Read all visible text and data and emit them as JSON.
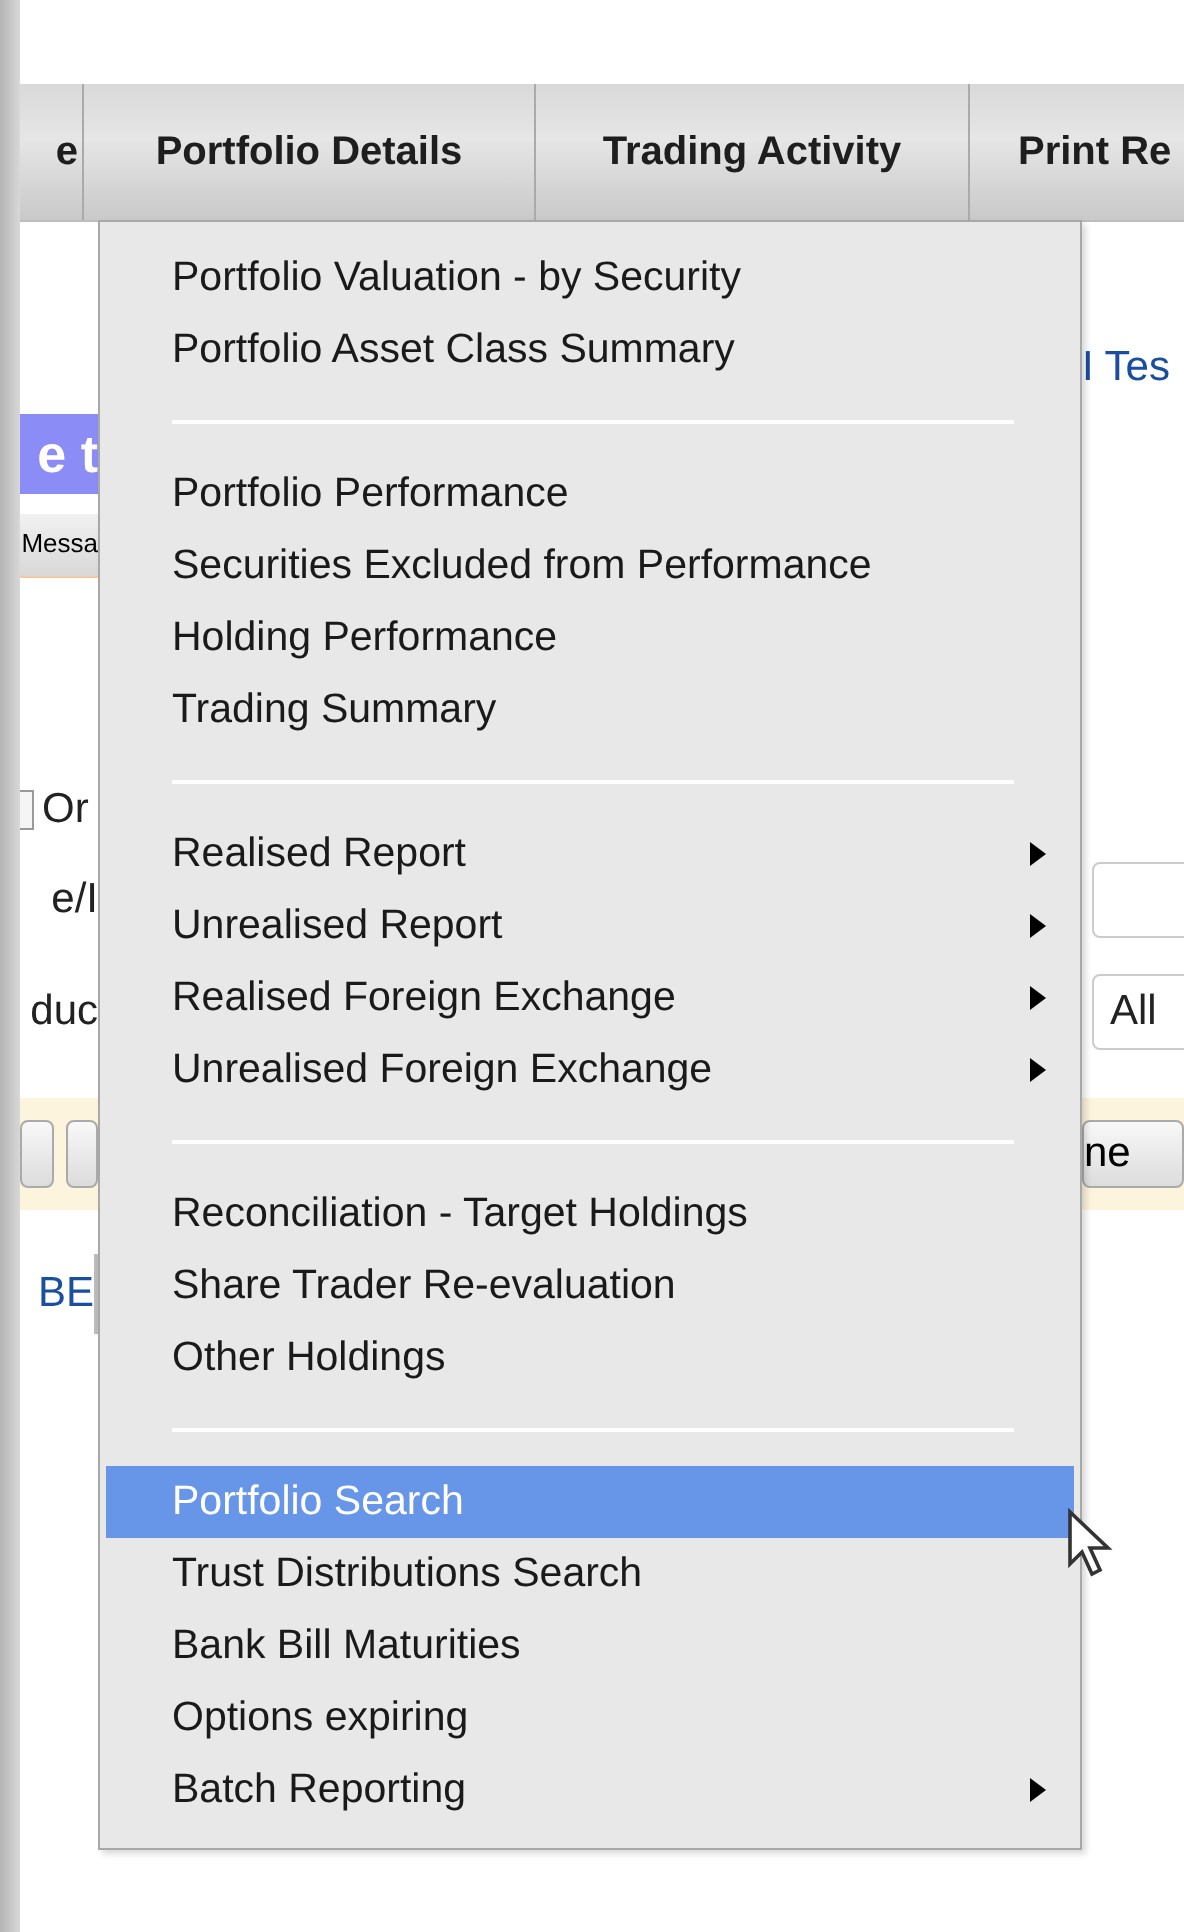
{
  "tabs": [
    {
      "label": "e"
    },
    {
      "label": "Portfolio Details"
    },
    {
      "label": "Trading Activity"
    },
    {
      "label": "Print Re"
    }
  ],
  "background": {
    "link_right": "I Tes",
    "banner": "e t",
    "message_tab": "Messa",
    "checkbox": {
      "label": "Or",
      "checked": false
    },
    "field_label": "e/I",
    "select_label": "duc",
    "select_value": "All",
    "toolbar_button": "ne",
    "row_link": "BE"
  },
  "menu": [
    {
      "kind": "item",
      "label": "Portfolio Valuation - by Security",
      "submenu": false,
      "selected": false
    },
    {
      "kind": "item",
      "label": "Portfolio Asset Class Summary",
      "submenu": false,
      "selected": false
    },
    {
      "kind": "separator"
    },
    {
      "kind": "item",
      "label": "Portfolio Performance",
      "submenu": false,
      "selected": false
    },
    {
      "kind": "item",
      "label": "Securities Excluded from Performance",
      "submenu": false,
      "selected": false
    },
    {
      "kind": "item",
      "label": "Holding Performance",
      "submenu": false,
      "selected": false
    },
    {
      "kind": "item",
      "label": "Trading Summary",
      "submenu": false,
      "selected": false
    },
    {
      "kind": "separator"
    },
    {
      "kind": "item",
      "label": "Realised Report",
      "submenu": true,
      "selected": false
    },
    {
      "kind": "item",
      "label": "Unrealised Report",
      "submenu": true,
      "selected": false
    },
    {
      "kind": "item",
      "label": "Realised Foreign Exchange",
      "submenu": true,
      "selected": false
    },
    {
      "kind": "item",
      "label": "Unrealised Foreign Exchange",
      "submenu": true,
      "selected": false
    },
    {
      "kind": "separator"
    },
    {
      "kind": "item",
      "label": "Reconciliation - Target Holdings",
      "submenu": false,
      "selected": false
    },
    {
      "kind": "item",
      "label": "Share Trader Re-evaluation",
      "submenu": false,
      "selected": false
    },
    {
      "kind": "item",
      "label": "Other Holdings",
      "submenu": false,
      "selected": false
    },
    {
      "kind": "separator"
    },
    {
      "kind": "item",
      "label": "Portfolio Search",
      "submenu": false,
      "selected": true
    },
    {
      "kind": "item",
      "label": "Trust Distributions Search",
      "submenu": false,
      "selected": false
    },
    {
      "kind": "item",
      "label": "Bank Bill Maturities",
      "submenu": false,
      "selected": false
    },
    {
      "kind": "item",
      "label": "Options expiring",
      "submenu": false,
      "selected": false
    },
    {
      "kind": "item",
      "label": "Batch Reporting",
      "submenu": true,
      "selected": false
    }
  ]
}
